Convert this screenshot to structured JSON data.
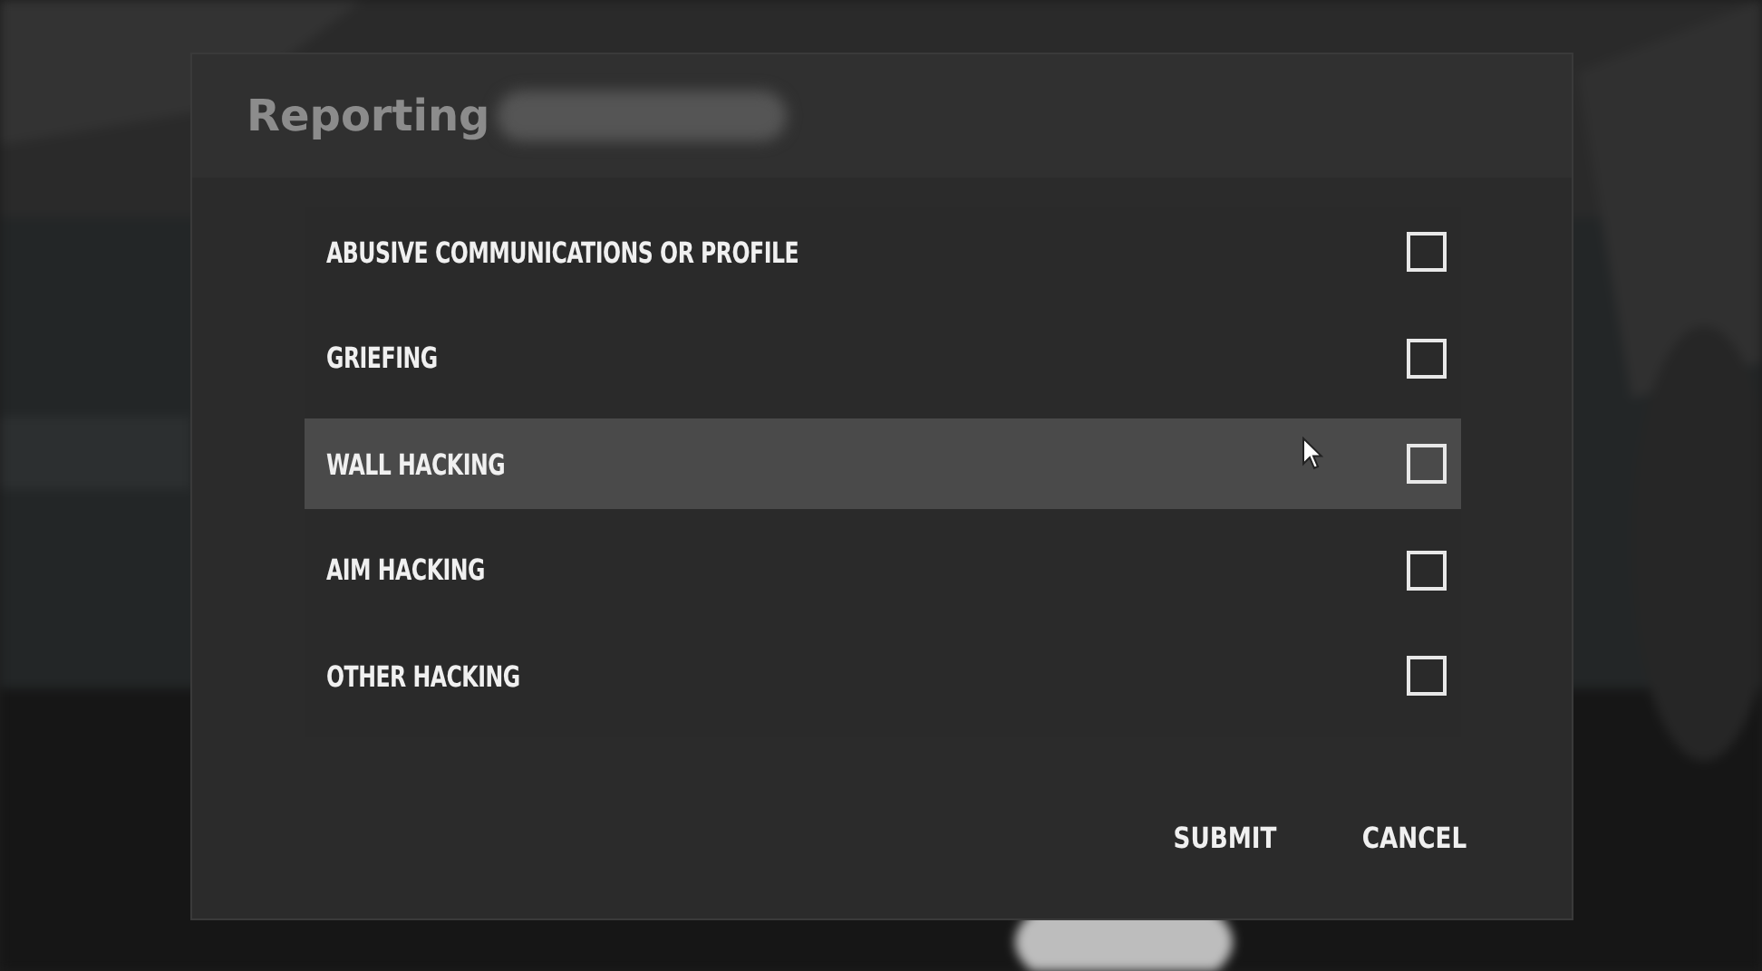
{
  "dialog": {
    "title": "Reporting",
    "name_redacted": true
  },
  "options": [
    {
      "label": "ABUSIVE COMMUNICATIONS OR PROFILE",
      "checked": false,
      "highlighted": false
    },
    {
      "label": "GRIEFING",
      "checked": false,
      "highlighted": false
    },
    {
      "label": "WALL HACKING",
      "checked": false,
      "highlighted": true
    },
    {
      "label": "AIM HACKING",
      "checked": false,
      "highlighted": false
    },
    {
      "label": "OTHER HACKING",
      "checked": false,
      "highlighted": false
    }
  ],
  "buttons": [
    "SUBMIT",
    "CANCEL"
  ]
}
